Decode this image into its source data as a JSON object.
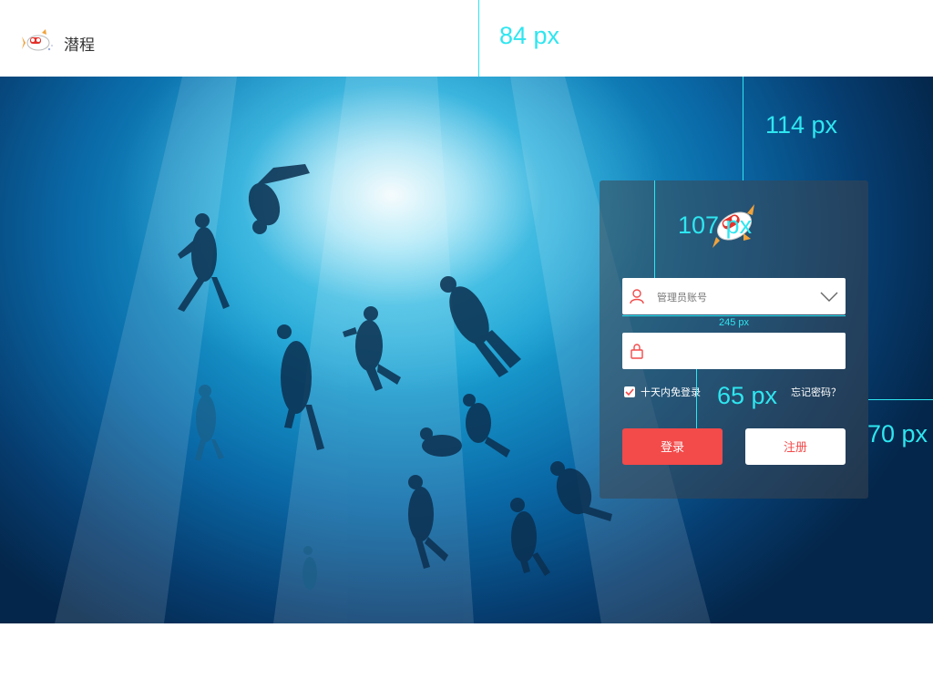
{
  "header": {
    "brand": "潜程",
    "logo_icon": "mascot-fish-icon"
  },
  "login": {
    "panel_logo_icon": "mascot-fish-icon",
    "username": {
      "icon": "user-icon",
      "placeholder": "管理员账号",
      "dropdown_icon": "chevron-down-icon"
    },
    "password": {
      "icon": "lock-icon",
      "value": ""
    },
    "remember_label": "十天内免登录",
    "remember_checked": true,
    "forgot_label": "忘记密码？",
    "login_button": "登录",
    "register_button": "注册"
  },
  "annotations": {
    "header_height": "84 px",
    "top_gap": "114 px",
    "logo_gap": "107 px",
    "input_width": "245 px",
    "input_gap": "65 px",
    "right_gap": "70 px"
  },
  "colors": {
    "accent": "#f34a4a",
    "annotation": "#2ee6f0",
    "panel": "rgba(60,70,80,0.55)"
  }
}
